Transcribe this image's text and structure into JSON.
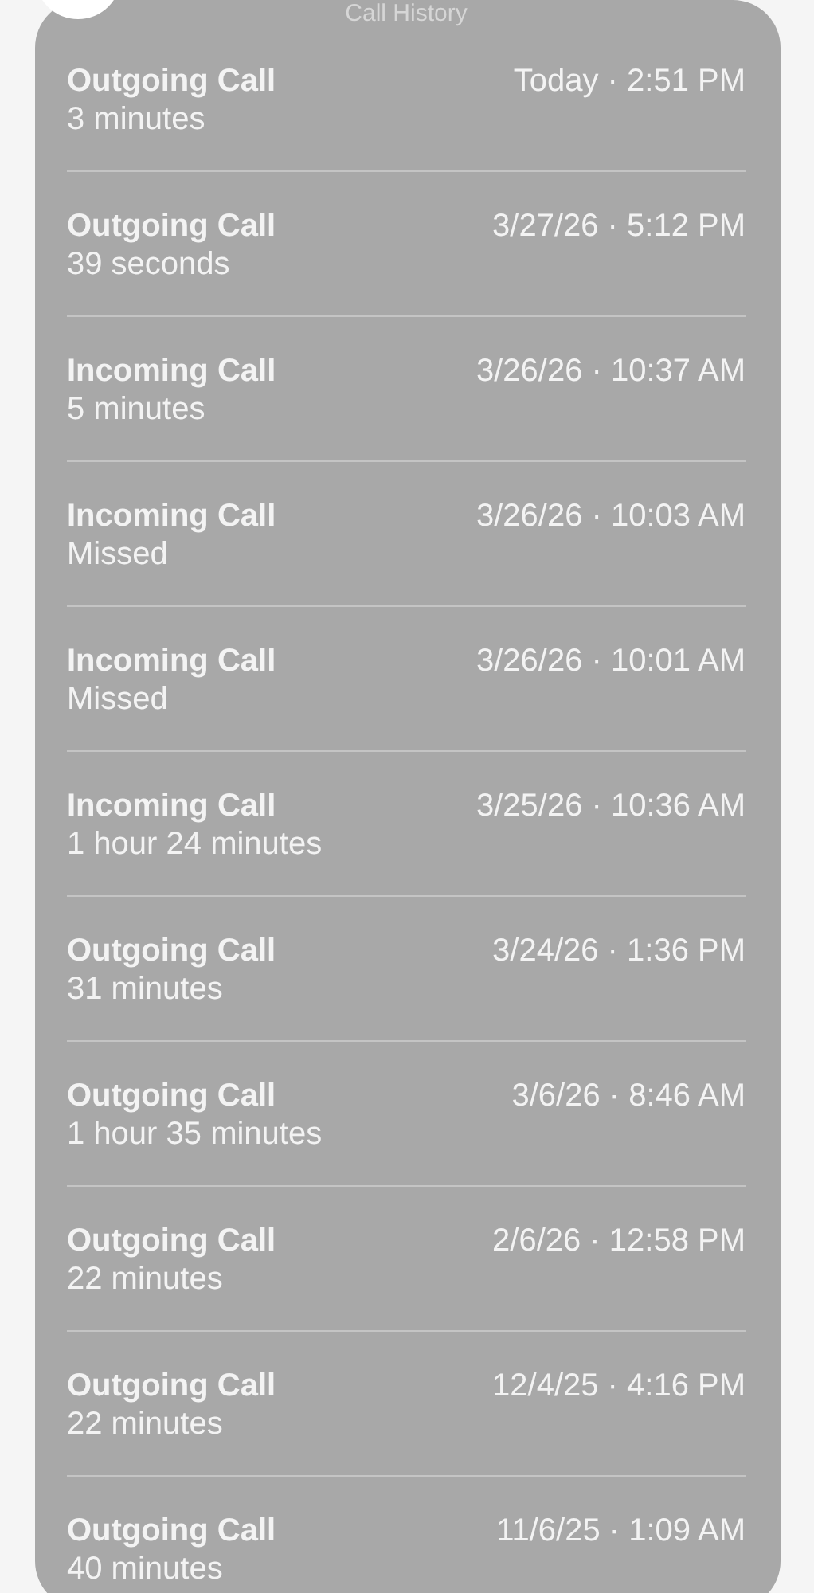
{
  "title": "Call History",
  "calls": [
    {
      "type": "Outgoing Call",
      "detail": "3 minutes",
      "time": "Today · 2:51 PM"
    },
    {
      "type": "Outgoing Call",
      "detail": "39 seconds",
      "time": "3/27/26 · 5:12 PM"
    },
    {
      "type": "Incoming Call",
      "detail": "5 minutes",
      "time": "3/26/26 · 10:37 AM"
    },
    {
      "type": "Incoming Call",
      "detail": "Missed",
      "time": "3/26/26 · 10:03 AM"
    },
    {
      "type": "Incoming Call",
      "detail": "Missed",
      "time": "3/26/26 · 10:01 AM"
    },
    {
      "type": "Incoming Call",
      "detail": "1 hour 24 minutes",
      "time": "3/25/26 · 10:36 AM"
    },
    {
      "type": "Outgoing Call",
      "detail": "31 minutes",
      "time": "3/24/26 · 1:36 PM"
    },
    {
      "type": "Outgoing Call",
      "detail": "1 hour 35 minutes",
      "time": "3/6/26 · 8:46 AM"
    },
    {
      "type": "Outgoing Call",
      "detail": "22 minutes",
      "time": "2/6/26 · 12:58 PM"
    },
    {
      "type": "Outgoing Call",
      "detail": "22 minutes",
      "time": "12/4/25 · 4:16 PM"
    },
    {
      "type": "Outgoing Call",
      "detail": "40 minutes",
      "time": "11/6/25 · 1:09 AM"
    }
  ]
}
